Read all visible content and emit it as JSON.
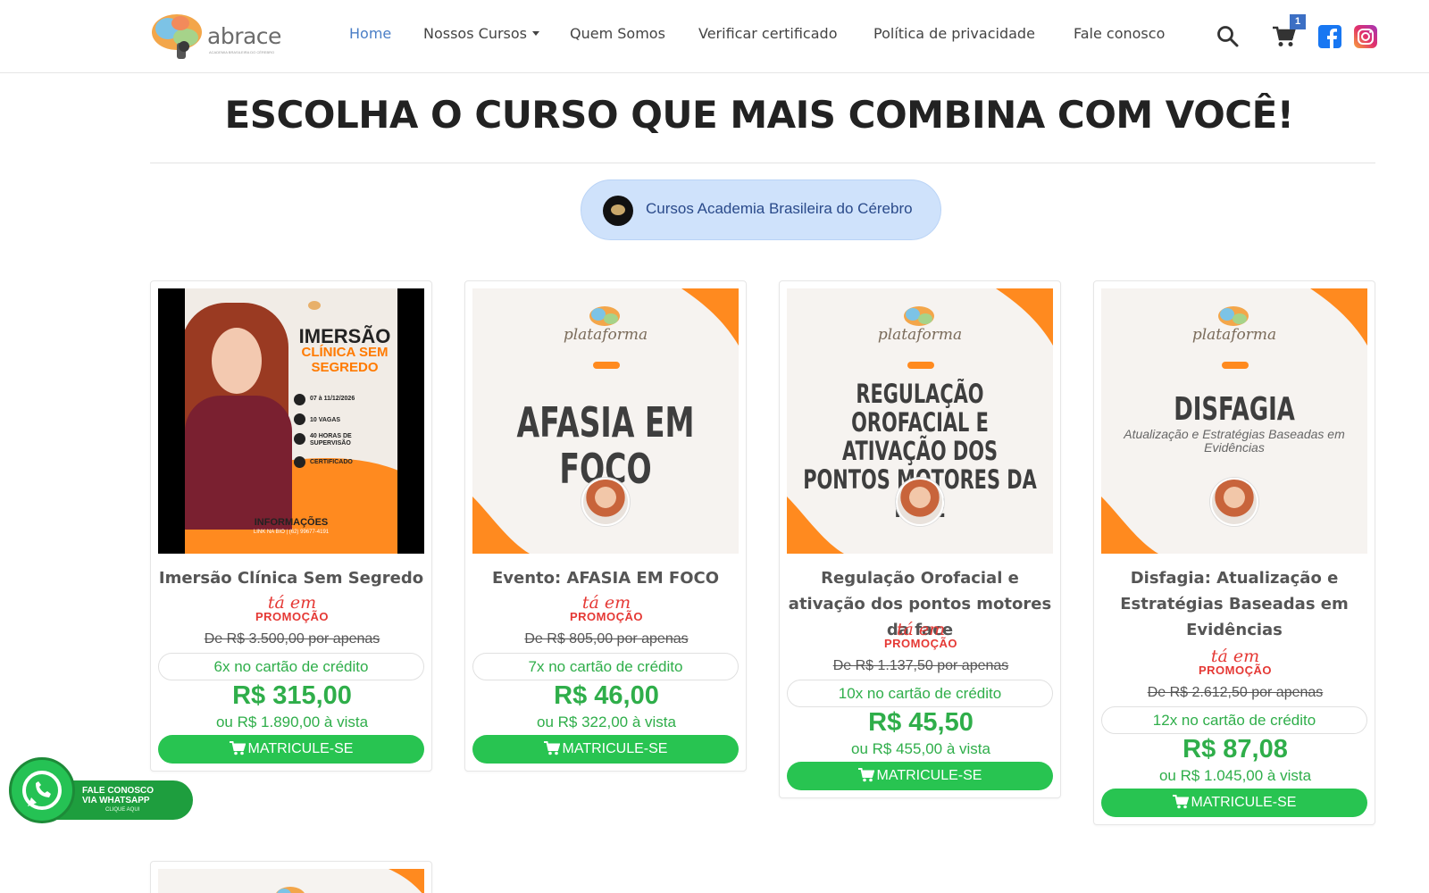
{
  "brand": {
    "name": "abrace",
    "tagline": "ACADEMIA BRASILEIRA DO CÉREBRO"
  },
  "nav": {
    "items": [
      {
        "label": "Home",
        "active": true
      },
      {
        "label": "Nossos Cursos",
        "dropdown": true
      },
      {
        "label": "Quem Somos"
      },
      {
        "label": "Verificar certificado"
      },
      {
        "label": "Política de privacidade"
      },
      {
        "label": "Fale conosco"
      }
    ],
    "icons": [
      "search-icon",
      "cart-icon",
      "facebook-icon",
      "instagram-icon"
    ],
    "cart_count": "1"
  },
  "page": {
    "title": "ESCOLHA O CURSO QUE MAIS COMBINA COM VOCÊ!",
    "category": "Cursos Academia Brasileira do Cérebro"
  },
  "promo": {
    "line1": "tá em",
    "line2": "PROMOÇÃO"
  },
  "enroll_label": "MATRICULE-SE",
  "courses": [
    {
      "title": "Imersão Clínica Sem Segredo",
      "old_price": "De R$ 3.500,00 por apenas",
      "installments": "6x no cartão de crédito",
      "price": "R$ 315,00",
      "cash": "ou R$ 1.890,00 à vista",
      "image": {
        "title_a": "IMERSÃO",
        "title_b": "CLÍNICA SEM SEGREDO",
        "date": "07 à 11/12/2026",
        "vacancies": "10 VAGAS",
        "hours": "40 HORAS DE SUPERVISÃO",
        "cert": "CERTIFICADO",
        "info": "INFORMAÇÕES",
        "contact": "LINK NA BIO | (62) 99677-4191"
      }
    },
    {
      "title": "Evento: AFASIA EM FOCO",
      "old_price": "De R$ 805,00 por apenas",
      "installments": "7x no cartão de crédito",
      "price": "R$ 46,00",
      "cash": "ou R$ 322,00 à vista",
      "image": {
        "brand": "plataforma",
        "headline": "AFASIA EM FOCO"
      }
    },
    {
      "title": "Regulação Orofacial e ativação dos pontos motores da face",
      "old_price": "De R$ 1.137,50 por apenas",
      "installments": "10x no cartão de crédito",
      "price": "R$ 45,50",
      "cash": "ou R$ 455,00 à vista",
      "image": {
        "brand": "plataforma",
        "headline": "REGULAÇÃO OROFACIAL E ATIVAÇÃO DOS PONTOS MOTORES DA FACE"
      }
    },
    {
      "title": "Disfagia: Atualização e Estratégias Baseadas em Evidências",
      "old_price": "De R$ 2.612,50 por apenas",
      "installments": "12x no cartão de crédito",
      "price": "R$ 87,08",
      "cash": "ou R$ 1.045,00 à vista",
      "image": {
        "brand": "plataforma",
        "headline": "DISFAGIA",
        "sub": "Atualização e Estratégias Baseadas em Evidências"
      }
    }
  ],
  "whatsapp": {
    "line1": "FALE CONOSCO",
    "line2": "VIA WHATSAPP",
    "line3": "CLIQUE AQUI"
  },
  "colors": {
    "accent_green": "#28c451",
    "price_green": "#2fae4a",
    "promo_red": "#e53935",
    "nav_active": "#4a7ec6",
    "orange": "#ff8a1f"
  }
}
